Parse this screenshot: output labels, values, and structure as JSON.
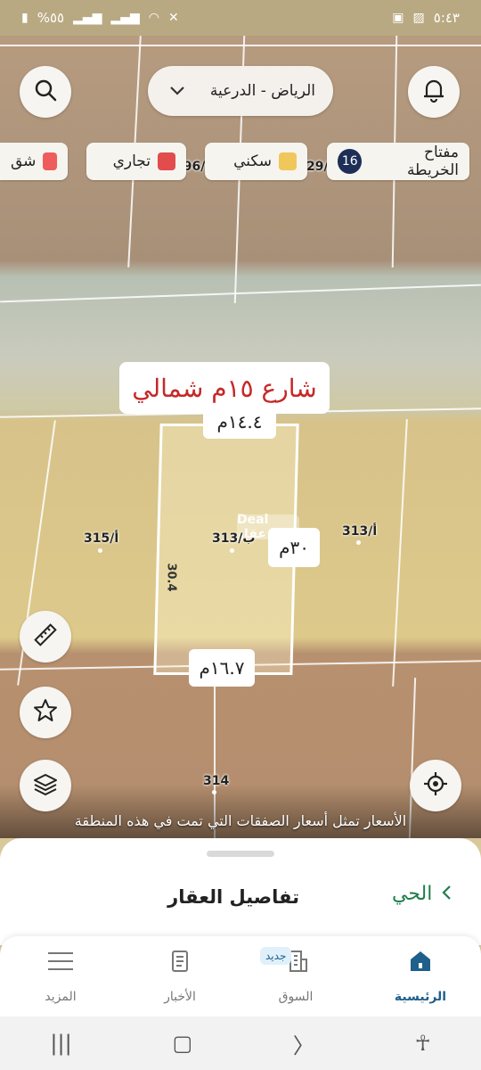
{
  "status_bar": {
    "time": "٥:٤٣",
    "battery": "%٥٥"
  },
  "search": {
    "location": "الرياض - الدرعية"
  },
  "legend": {
    "key_label": "مفتاح الخريطة",
    "key_count": "16",
    "items": [
      {
        "label": "سكني",
        "color": "#f0c75a"
      },
      {
        "label": "تجاري",
        "color": "#e24c4c"
      },
      {
        "label": "شق",
        "color": "#ee5c5c"
      }
    ]
  },
  "map": {
    "street_name": "شارع ١٥م شمالي",
    "dimensions": {
      "top": "١٤.٤م",
      "right": "٣٠م",
      "bottom": "١٦.٧م",
      "side_left": "30.4"
    },
    "parcels": [
      "313/ب",
      "313/أ",
      "315/أ",
      "314",
      "296/",
      "29/ب"
    ],
    "watermark": "Deal عقار",
    "note": "الأسعار تمثل أسعار الصفقات التي تمت في هذه المنطقة"
  },
  "sheet": {
    "title": "تفاصيل العقار",
    "link": "الحي"
  },
  "nav": {
    "items": [
      {
        "label": "الرئيسية"
      },
      {
        "label": "السوق",
        "badge": "جديد"
      },
      {
        "label": "الأخبار"
      },
      {
        "label": "المزيد"
      }
    ]
  }
}
